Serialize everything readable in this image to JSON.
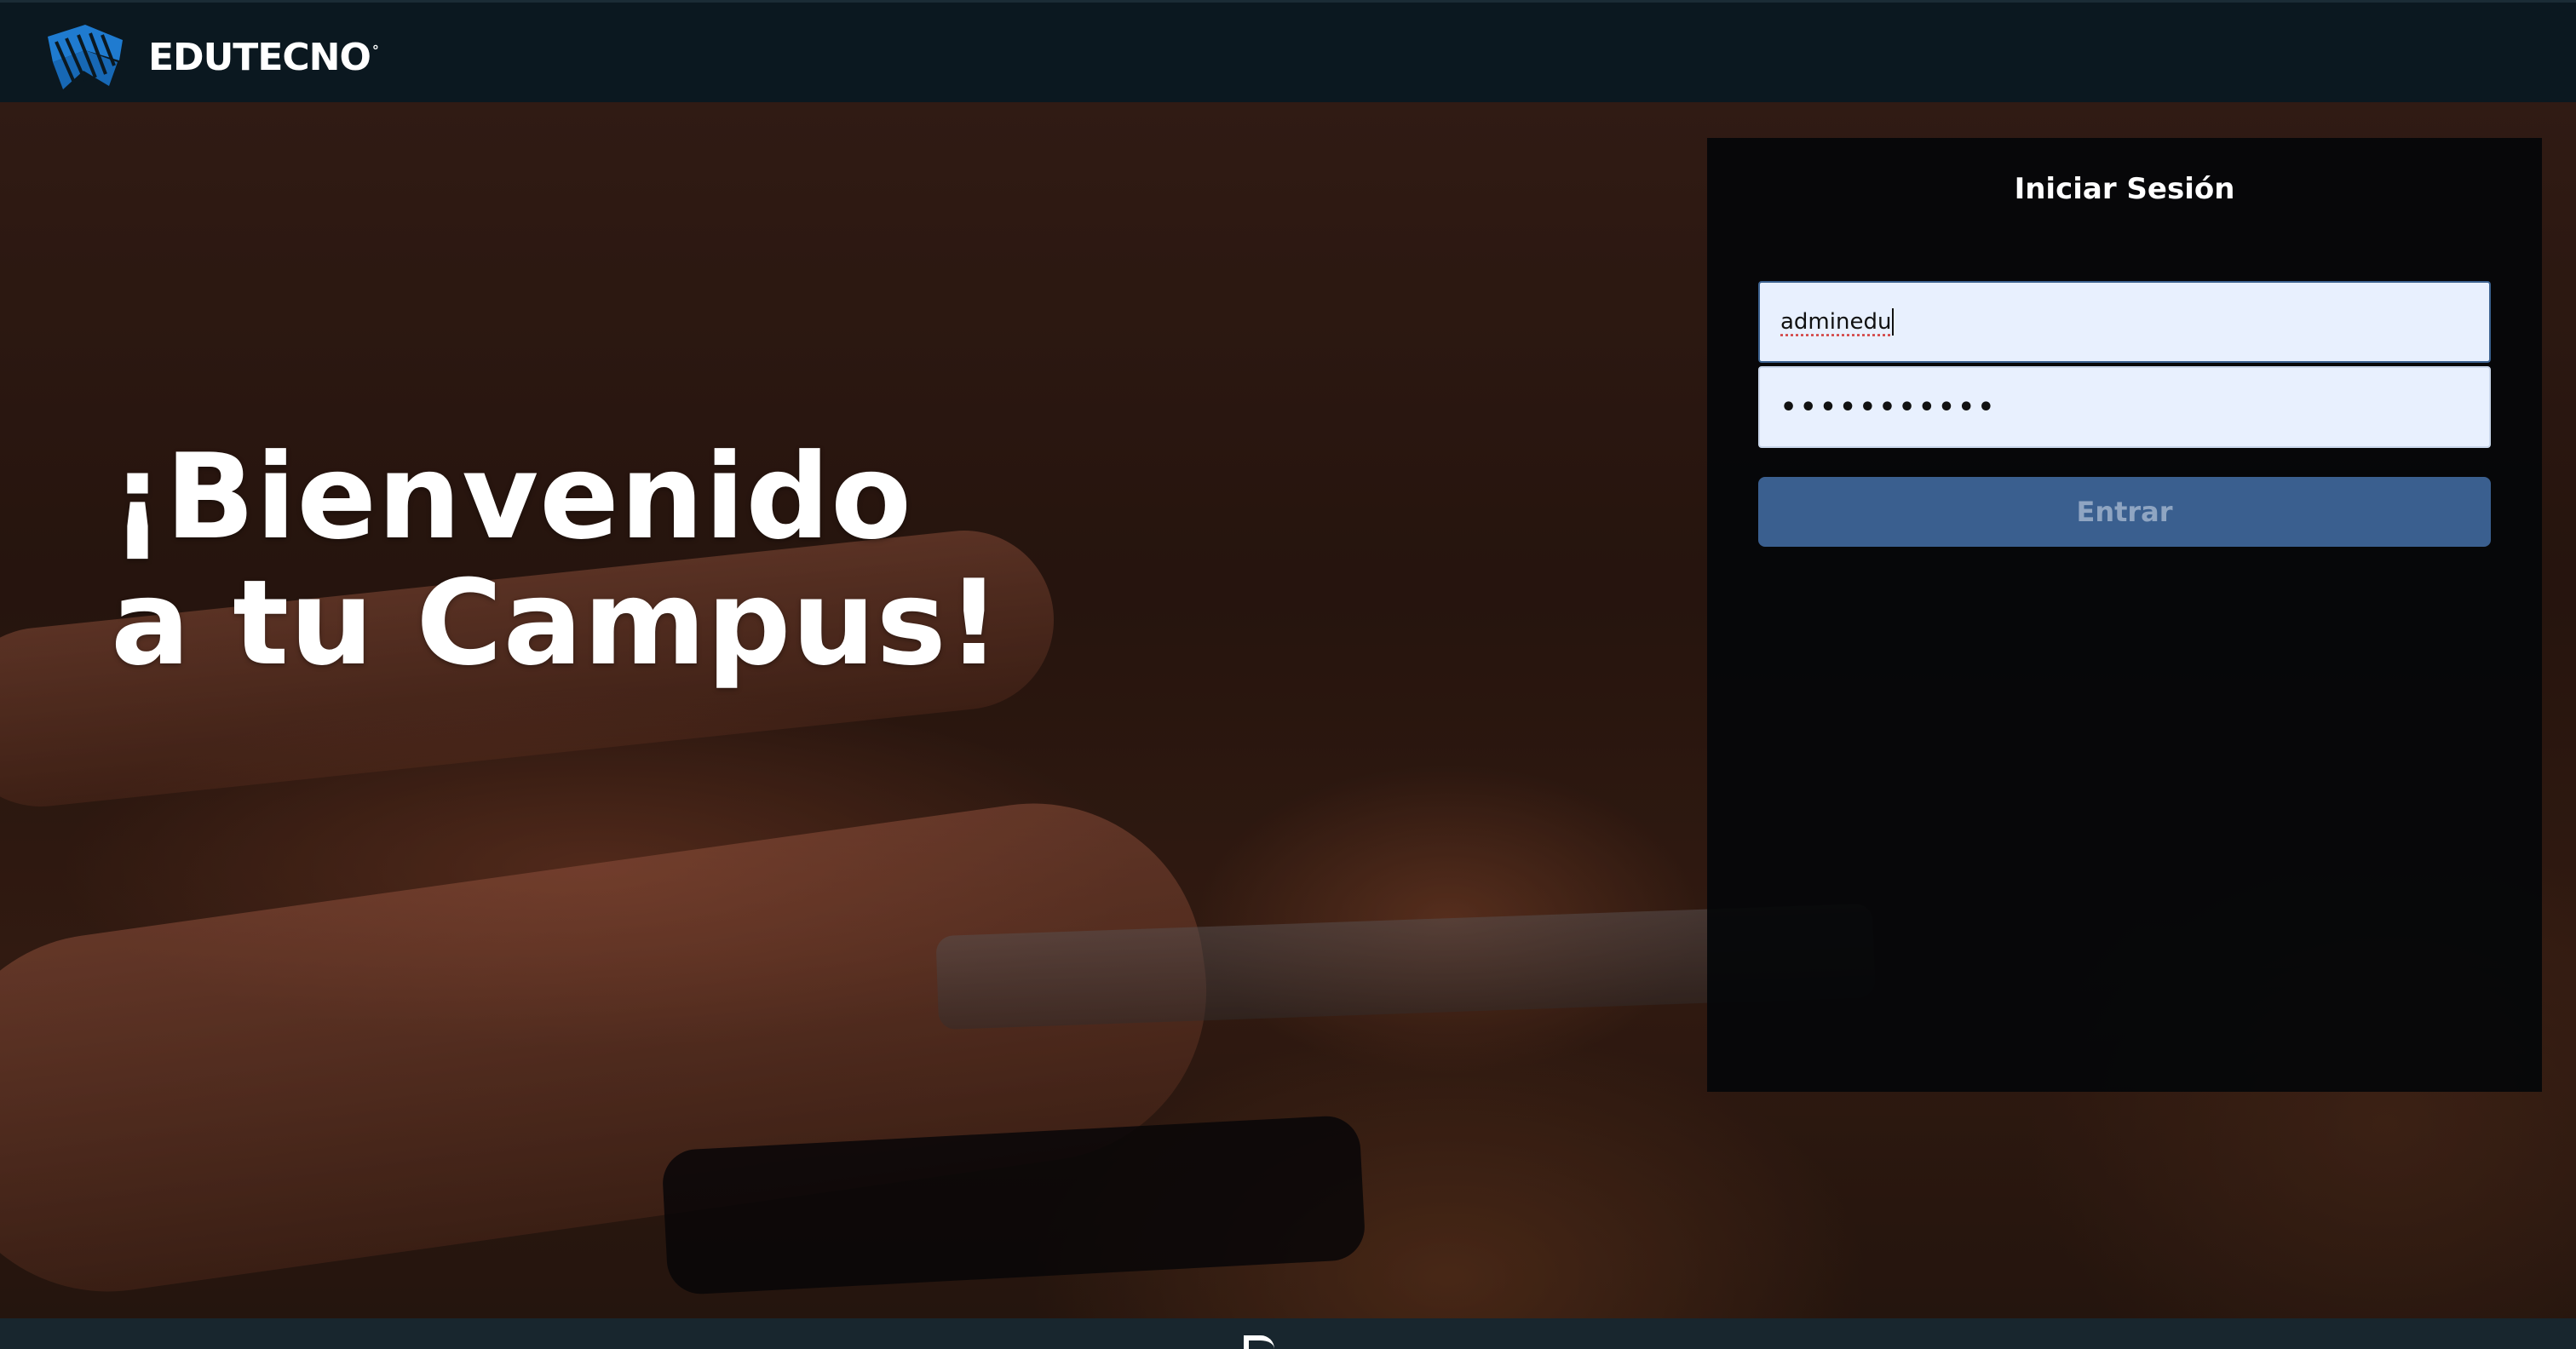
{
  "header": {
    "brand_name": "EDUTECNO",
    "brand_mark_symbol": "°",
    "logo_icon": "edutecno-logo-icon"
  },
  "hero": {
    "headline_line1": "¡Bienvenido",
    "headline_line2": "a tu Campus!"
  },
  "login": {
    "title": "Iniciar Sesión",
    "username_value": "adminedu",
    "password_masked": "•••••••••••",
    "submit_label": "Entrar"
  },
  "colors": {
    "topbar_bg": "#0b1820",
    "panel_bg": "#040609",
    "input_bg": "#e8f0fe",
    "button_bg": "#3a5f8f",
    "button_text": "#8fa5c2",
    "logo_blue": "#1f7bd0"
  }
}
